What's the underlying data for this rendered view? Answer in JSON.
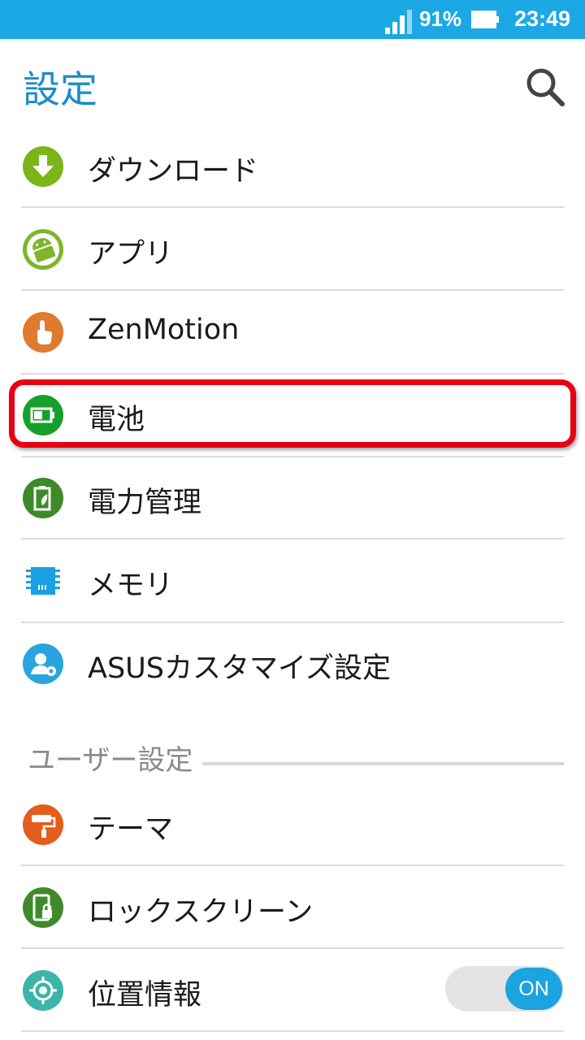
{
  "status_bar": {
    "battery_percent": "91%",
    "time": "23:49",
    "signal_icon": "signal-icon",
    "battery_icon": "battery-icon"
  },
  "header": {
    "title": "設定",
    "search_icon": "search-icon"
  },
  "items": [
    {
      "label": "ダウンロード",
      "icon": "download-icon",
      "color": "#7cb518"
    },
    {
      "label": "アプリ",
      "icon": "android-icon",
      "color": "#7fb52a"
    },
    {
      "label": "ZenMotion",
      "icon": "touch-gesture-icon",
      "color": "#e07a2e"
    },
    {
      "label": "電池",
      "icon": "battery-icon",
      "color": "#16a02b"
    },
    {
      "label": "電力管理",
      "icon": "power-management-icon",
      "color": "#3c8a2a"
    },
    {
      "label": "メモリ",
      "icon": "memory-chip-icon",
      "color": "#1aa0e2"
    },
    {
      "label": "ASUSカスタマイズ設定",
      "icon": "user-settings-icon",
      "color": "#2aa4de"
    }
  ],
  "section_user": {
    "label": "ユーザー設定"
  },
  "user_items": [
    {
      "label": "テーマ",
      "icon": "paint-roller-icon",
      "color": "#e35d1c"
    },
    {
      "label": "ロックスクリーン",
      "icon": "lock-screen-icon",
      "color": "#3f8a2a"
    },
    {
      "label": "位置情報",
      "icon": "location-icon",
      "color": "#3bb5a7",
      "toggle": "ON"
    }
  ],
  "highlight_color": "#e60012"
}
